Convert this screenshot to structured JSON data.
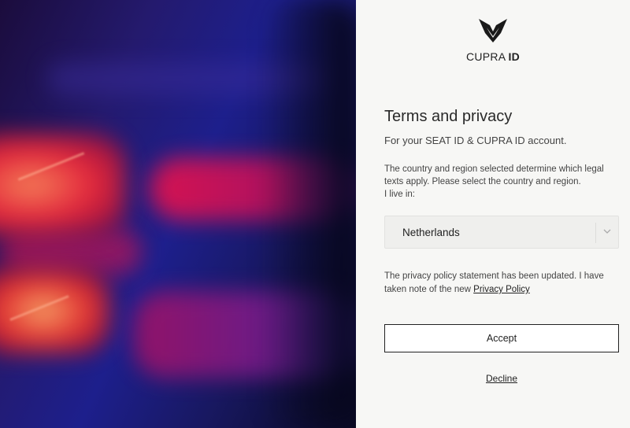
{
  "brand": {
    "name": "CUPRA",
    "suffix": "ID"
  },
  "terms": {
    "title": "Terms and privacy",
    "subtitle": "For your SEAT ID & CUPRA ID account.",
    "info_line1": "The country and region selected determine which legal texts apply. Please select the country and region.",
    "info_line2": "I live in:"
  },
  "country_select": {
    "value": "Netherlands"
  },
  "policy": {
    "text": "The privacy policy statement has been updated. I have taken note of the new ",
    "link": "Privacy Policy"
  },
  "actions": {
    "accept": "Accept",
    "decline": "Decline"
  },
  "colors": {
    "text": "#222222",
    "panel": "#f7f7f5",
    "select_bg": "#efefed"
  },
  "icons": [
    "cupra-logo-icon",
    "chevron-down-icon"
  ]
}
